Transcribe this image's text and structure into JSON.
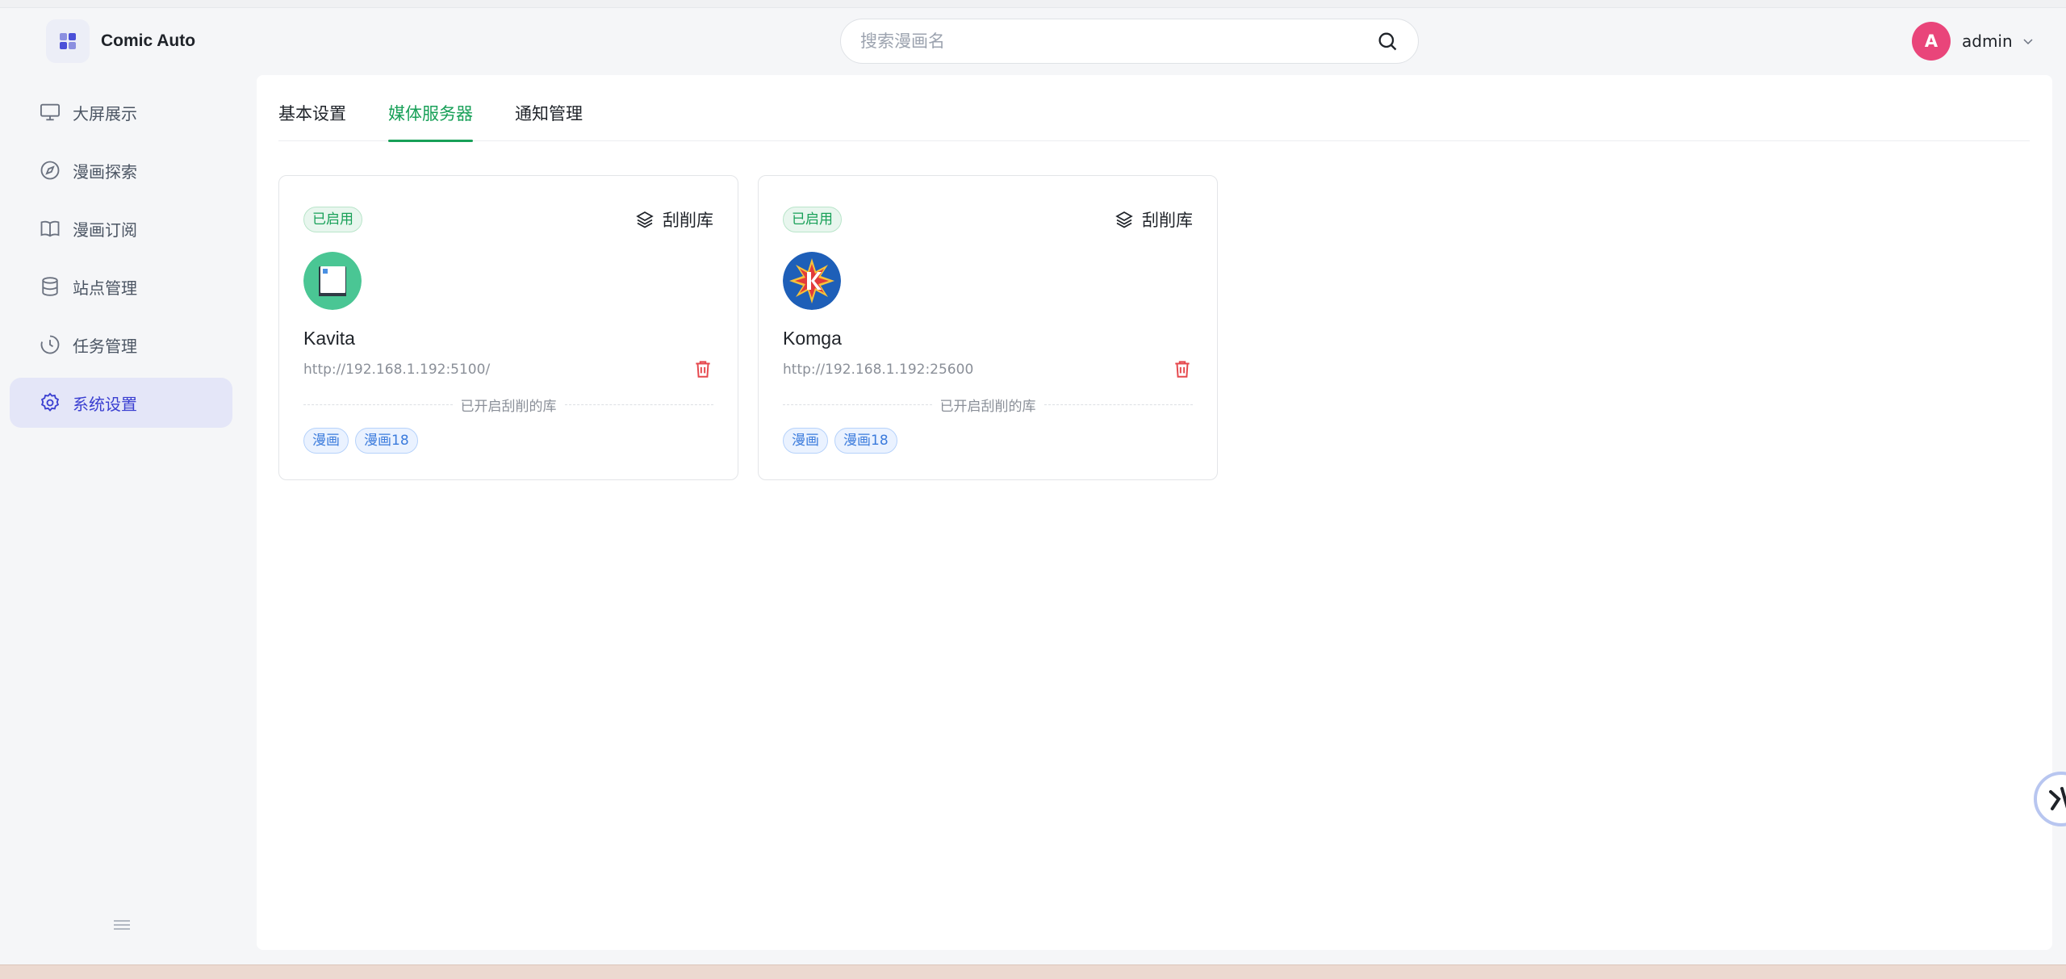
{
  "app": {
    "name": "Comic Auto"
  },
  "search": {
    "placeholder": "搜索漫画名"
  },
  "user": {
    "initial": "A",
    "name": "admin"
  },
  "sidebar": {
    "items": [
      {
        "label": "大屏展示",
        "icon": "monitor-icon"
      },
      {
        "label": "漫画探索",
        "icon": "compass-icon"
      },
      {
        "label": "漫画订阅",
        "icon": "book-open-icon"
      },
      {
        "label": "站点管理",
        "icon": "database-icon"
      },
      {
        "label": "任务管理",
        "icon": "clock-icon"
      },
      {
        "label": "系统设置",
        "icon": "gear-icon",
        "active": true
      }
    ]
  },
  "tabs": [
    {
      "label": "基本设置"
    },
    {
      "label": "媒体服务器",
      "active": true
    },
    {
      "label": "通知管理"
    }
  ],
  "servers": [
    {
      "status": "已启用",
      "scrape_label": "刮削库",
      "name": "Kavita",
      "url": "http://192.168.1.192:5100/",
      "divider": "已开启刮削的库",
      "tags": [
        "漫画",
        "漫画18"
      ],
      "logo": "kavita-logo"
    },
    {
      "status": "已启用",
      "scrape_label": "刮削库",
      "name": "Komga",
      "url": "http://192.168.1.192:25600",
      "divider": "已开启刮削的库",
      "tags": [
        "漫画",
        "漫画18"
      ],
      "logo": "komga-logo"
    }
  ],
  "colors": {
    "accent": "#18a058",
    "sidebar_active": "#3a3fd1",
    "avatar": "#e9457a",
    "danger": "#e5484d",
    "tag": "#3b7bdc"
  }
}
